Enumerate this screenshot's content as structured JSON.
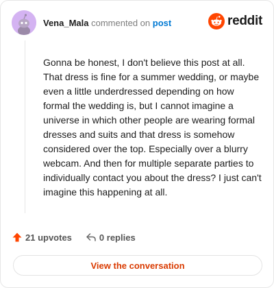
{
  "comment": {
    "username": "Vena_Mala",
    "action_text": "commented on",
    "post_link": "post",
    "body": "Gonna be honest, I don't believe this post at all. That dress is fine for a summer wedding, or maybe even a little underdressed depending on how formal the wedding is, but I cannot imagine a universe in which other people are wearing formal dresses and suits and that dress is somehow considered over the top. Especially over a blurry webcam. And then for multiple separate parties to individually contact you about the dress? I just can't imagine this happening at all."
  },
  "brand": {
    "wordmark": "reddit",
    "color": "#ff4500"
  },
  "actions": {
    "upvotes": "21 upvotes",
    "replies": "0 replies",
    "upvote_icon": "upvote-arrow-icon",
    "reply_icon": "reply-arrow-icon"
  },
  "cta": {
    "label": "View the conversation"
  },
  "colors": {
    "avatar_bg": "#d4b3f2",
    "link": "#0079d3",
    "cta": "#d93a00",
    "upvote": "#ff4500"
  }
}
